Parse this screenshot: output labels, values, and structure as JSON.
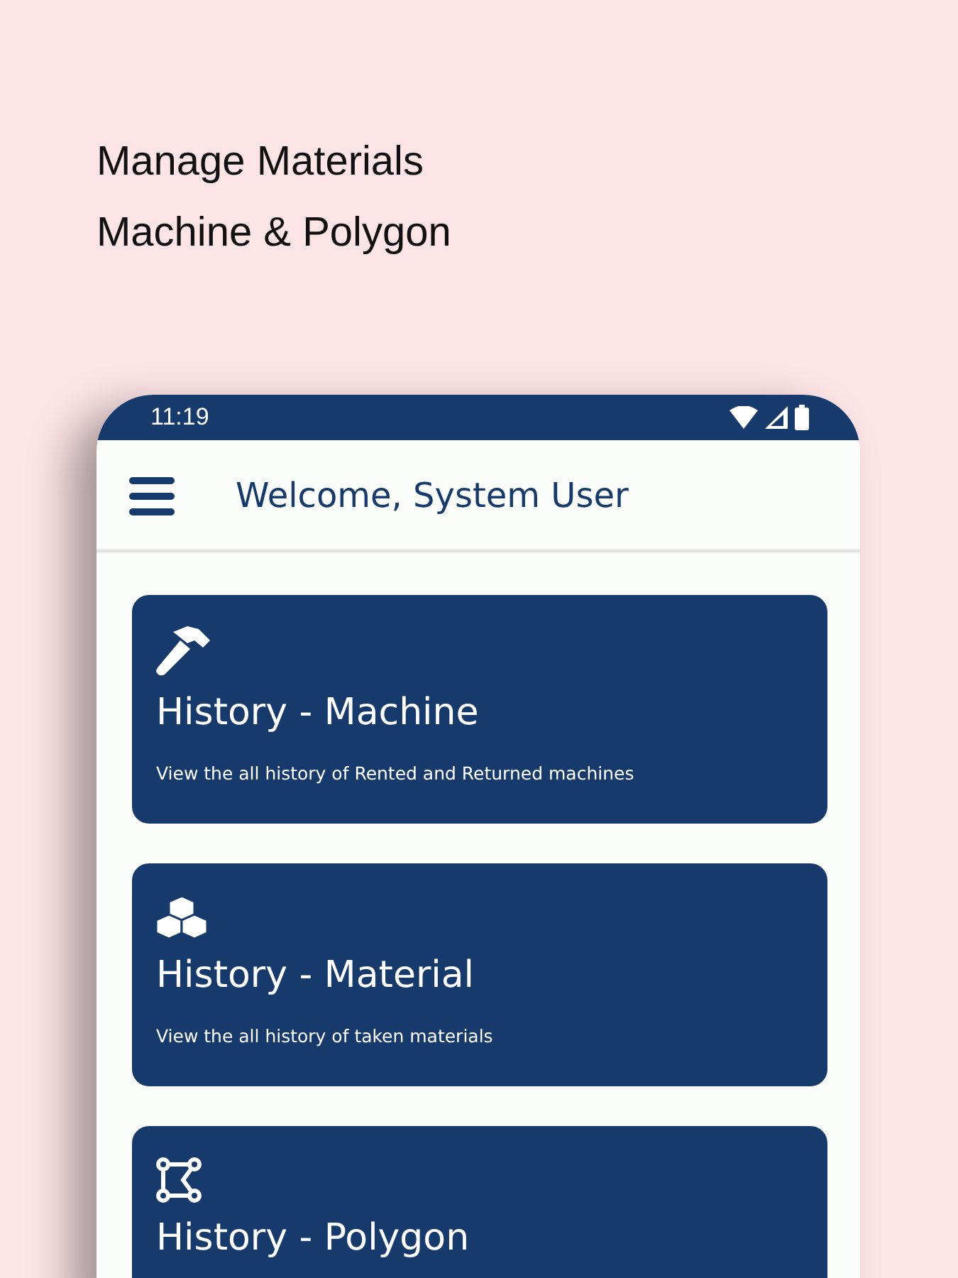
{
  "headline": [
    "Manage Materials",
    "Machine & Polygon"
  ],
  "status_bar": {
    "time": "11:19"
  },
  "app_bar": {
    "title": "Welcome, System User"
  },
  "cards": [
    {
      "kind": "hammer",
      "title": "History - Machine",
      "description": "View the all history of Rented and Returned machines"
    },
    {
      "kind": "cubes",
      "title": "History - Material",
      "description": "View the all history of taken materials"
    },
    {
      "kind": "polygon",
      "title": "History - Polygon"
    }
  ]
}
